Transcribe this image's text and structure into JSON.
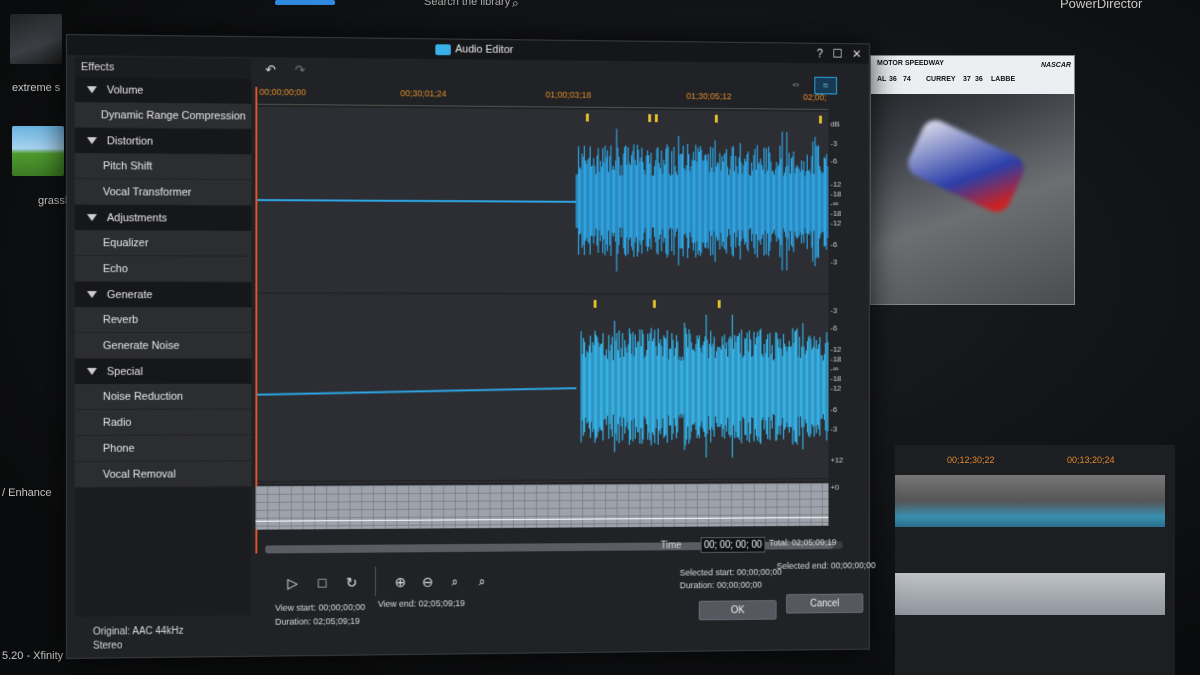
{
  "background": {
    "app_title": "PowerDirector",
    "search_placeholder": "Search the library",
    "media": [
      {
        "label": "extreme s"
      },
      {
        "label": "grassl"
      }
    ],
    "enhance_label": "/ Enhance",
    "bottom_label": "5.20 - Xfinity",
    "timeline_codes": [
      "00;12;30;22",
      "00;13;20;24"
    ],
    "preview_overlay": {
      "venue": "MOTOR SPEEDWAY",
      "brand": "NASCAR",
      "standings": [
        "AL",
        "36",
        "74",
        "CURREY",
        "37",
        "36",
        "LABBE"
      ]
    }
  },
  "dialog": {
    "title": "Audio Editor",
    "window_buttons": [
      "?",
      "☐",
      "✕"
    ],
    "effects_header": "Effects",
    "categories": [
      {
        "label": "Volume",
        "items": [
          "Dynamic Range Compression"
        ]
      },
      {
        "label": "Distortion",
        "items": [
          "Pitch Shift",
          "Vocal Transformer"
        ]
      },
      {
        "label": "Adjustments",
        "items": [
          "Equalizer",
          "Echo"
        ]
      },
      {
        "label": "Generate",
        "items": [
          "Reverb",
          "Generate Noise"
        ]
      },
      {
        "label": "Special",
        "items": [
          "Noise Reduction",
          "Radio",
          "Phone",
          "Vocal Removal"
        ]
      }
    ],
    "ruler": [
      "00;00;00;00",
      "00;30;01;24",
      "01;00;03;18",
      "01;30;05;12",
      "02;00;"
    ],
    "db_scale_top": [
      "dB",
      "-3",
      "-6",
      "-12",
      "-18",
      "-∞",
      "-18",
      "-12",
      "-6",
      "-3"
    ],
    "db_scale_bottom": [
      "-3",
      "-6",
      "-12",
      "-18",
      "-∞",
      "-18",
      "-12",
      "-6",
      "-3"
    ],
    "envelope_scale": [
      "+12",
      "+0"
    ],
    "time_label": "Time",
    "time_value": "00; 00; 00; 00",
    "total": "Total: 02;05;09;19",
    "selected_start": "Selected start: 00;00;00;00",
    "selected_end": "Selected end: 00;00;00;00",
    "selected_duration": "Duration: 00;00;00;00",
    "view_start": "View start: 00;00;00;00",
    "view_end": "View end: 02;05;09;19",
    "view_duration": "Duration: 02;05;09;19",
    "original_format": "Original: AAC 44kHz",
    "channels": "Stereo",
    "ok_label": "OK",
    "cancel_label": "Cancel",
    "accent_color": "#2ea6e6"
  }
}
